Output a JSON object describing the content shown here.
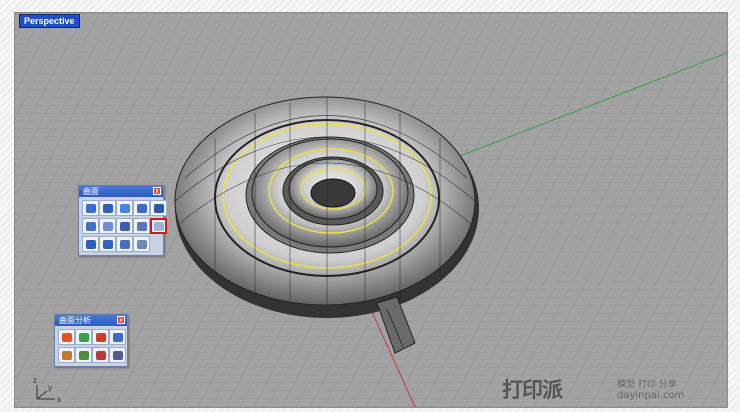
{
  "viewport": {
    "label": "Perspective",
    "axis_x": "x",
    "axis_z": "z",
    "axis_y": "y"
  },
  "toolbar_surface": {
    "title": "曲面",
    "close_glyph": "x",
    "buttons": [
      {
        "icon": "corner-points-surface-icon",
        "color": "#3a6bd0"
      },
      {
        "icon": "edge-curves-surface-icon",
        "color": "#2f5fb8"
      },
      {
        "icon": "sphere-surface-icon",
        "color": "#4b83e0"
      },
      {
        "icon": "plane-surface-icon",
        "color": "#3e6cc4"
      },
      {
        "icon": "extrude-surface-icon",
        "color": "#2c58a8"
      },
      {
        "icon": "loft-surface-icon",
        "color": "#4470c8"
      },
      {
        "icon": "sweep1-surface-icon",
        "color": "#6a8fd4"
      },
      {
        "icon": "network-surface-icon",
        "color": "#3b5fa9"
      },
      {
        "icon": "patch-surface-icon",
        "color": "#5577bb"
      },
      {
        "icon": "sweep2-surface-icon",
        "color": "#9fb3dc"
      },
      {
        "icon": "revolve-surface-icon",
        "color": "#2d5eb8"
      },
      {
        "icon": "rail-revolve-surface-icon",
        "color": "#3462b9"
      },
      {
        "icon": "blend-surface-icon",
        "color": "#4a6fc0"
      },
      {
        "icon": "heightfield-surface-icon",
        "color": "#6f86b8"
      }
    ]
  },
  "toolbar_analysis": {
    "title": "曲面分析",
    "close_glyph": "x",
    "buttons": [
      {
        "icon": "curvature-analysis-icon",
        "color": "#e0542c"
      },
      {
        "icon": "draft-angle-analysis-icon",
        "color": "#3aa04a"
      },
      {
        "icon": "environment-map-icon",
        "color": "#c8421e"
      },
      {
        "icon": "zebra-analysis-icon",
        "color": "#3b6ac8"
      },
      {
        "icon": "edge-continuity-icon",
        "color": "#c27a2a"
      },
      {
        "icon": "emap-analysis-icon",
        "color": "#4a8d3c"
      },
      {
        "icon": "thickness-analysis-icon",
        "color": "#b83a3a"
      },
      {
        "icon": "deviation-analysis-icon",
        "color": "#5a5a8a"
      }
    ]
  },
  "watermark": {
    "big": "打印派",
    "small": "模型 打印 分享",
    "url": "dayinpai.com"
  },
  "colors": {
    "accent": "#1e4fc8",
    "grid_axis_green": "#3aa04a",
    "grid_axis_red": "#c83a3a",
    "curve_yellow": "#f0e040"
  }
}
